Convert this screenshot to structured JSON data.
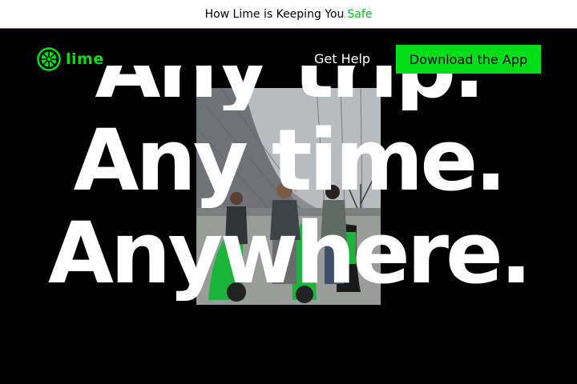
{
  "banner": {
    "text": "How Lime is Keeping You",
    "highlight": "Safe"
  },
  "nav": {
    "logo_text": "lime",
    "get_help": "Get Help",
    "download": "Download the App"
  },
  "hero": {
    "line1": "Any trip.",
    "line2": "Any time.",
    "line3": "Anywhere."
  },
  "colors": {
    "brand_green": "#00de1a",
    "background": "#000000"
  }
}
